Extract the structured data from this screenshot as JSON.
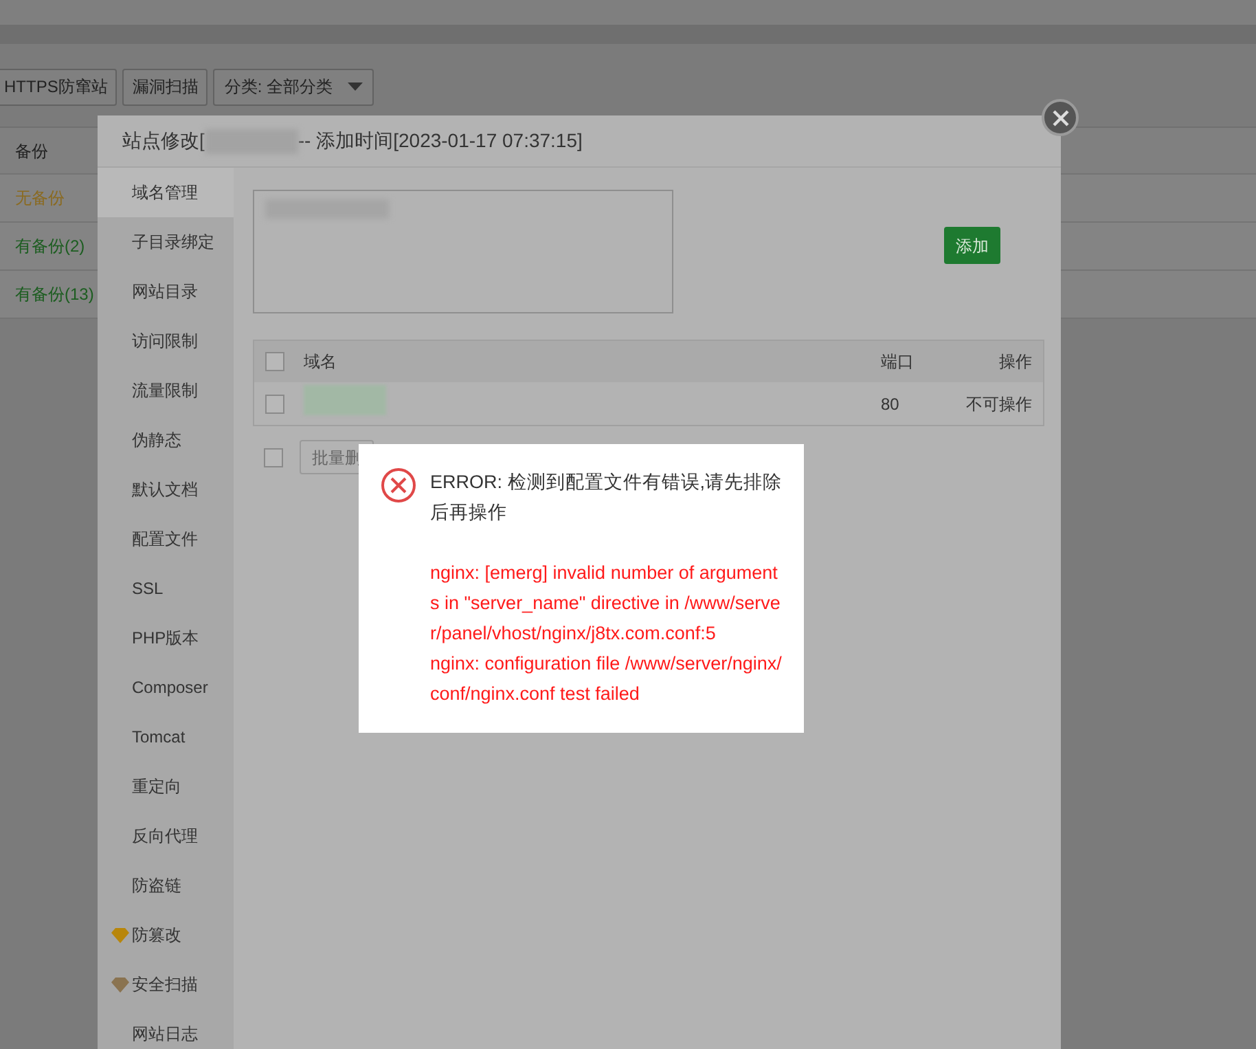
{
  "toolbar": {
    "buttons": [
      "HTTPS防窜站",
      "漏洞扫描"
    ],
    "category_select": "分类: 全部分类"
  },
  "site_table": {
    "column": "备份",
    "rows": [
      {
        "text": "无备份",
        "kind": "none"
      },
      {
        "text": "有备份(2)",
        "kind": "has"
      },
      {
        "text": "有备份(13)",
        "kind": "has"
      }
    ]
  },
  "modal": {
    "title_prefix": "站点修改[",
    "title_suffix": "-- 添加时间[2023-01-17 07:37:15]",
    "sidebar": [
      {
        "label": "域名管理",
        "selected": true,
        "kind": "plain"
      },
      {
        "label": "子目录绑定",
        "selected": false,
        "kind": "plain"
      },
      {
        "label": "网站目录",
        "selected": false,
        "kind": "plain"
      },
      {
        "label": "访问限制",
        "selected": false,
        "kind": "plain"
      },
      {
        "label": "流量限制",
        "selected": false,
        "kind": "plain"
      },
      {
        "label": "伪静态",
        "selected": false,
        "kind": "plain"
      },
      {
        "label": "默认文档",
        "selected": false,
        "kind": "plain"
      },
      {
        "label": "配置文件",
        "selected": false,
        "kind": "plain"
      },
      {
        "label": "SSL",
        "selected": false,
        "kind": "plain"
      },
      {
        "label": "PHP版本",
        "selected": false,
        "kind": "plain"
      },
      {
        "label": "Composer",
        "selected": false,
        "kind": "plain"
      },
      {
        "label": "Tomcat",
        "selected": false,
        "kind": "plain"
      },
      {
        "label": "重定向",
        "selected": false,
        "kind": "plain"
      },
      {
        "label": "反向代理",
        "selected": false,
        "kind": "plain"
      },
      {
        "label": "防盗链",
        "selected": false,
        "kind": "plain"
      },
      {
        "label": "防篡改",
        "selected": false,
        "kind": "gold"
      },
      {
        "label": "安全扫描",
        "selected": false,
        "kind": "bronze"
      },
      {
        "label": "网站日志",
        "selected": false,
        "kind": "plain"
      }
    ],
    "add_button": "添加",
    "domain_table": {
      "columns": [
        "域名",
        "端口",
        "操作"
      ],
      "all_checked": false,
      "rows": [
        {
          "port": "80",
          "action": "不可操作",
          "checked": false
        }
      ]
    },
    "batch_checked": false,
    "batch_button": "批量删"
  },
  "error_dialog": {
    "message": "ERROR: 检测到配置文件有错误,请先排除后再操作",
    "details": [
      "nginx: [emerg] invalid number of arguments in \"server_name\" directive in /www/server/panel/vhost/nginx/j8tx.com.conf:5",
      "nginx: configuration file /www/server/nginx/conf/nginx.conf test failed"
    ]
  }
}
